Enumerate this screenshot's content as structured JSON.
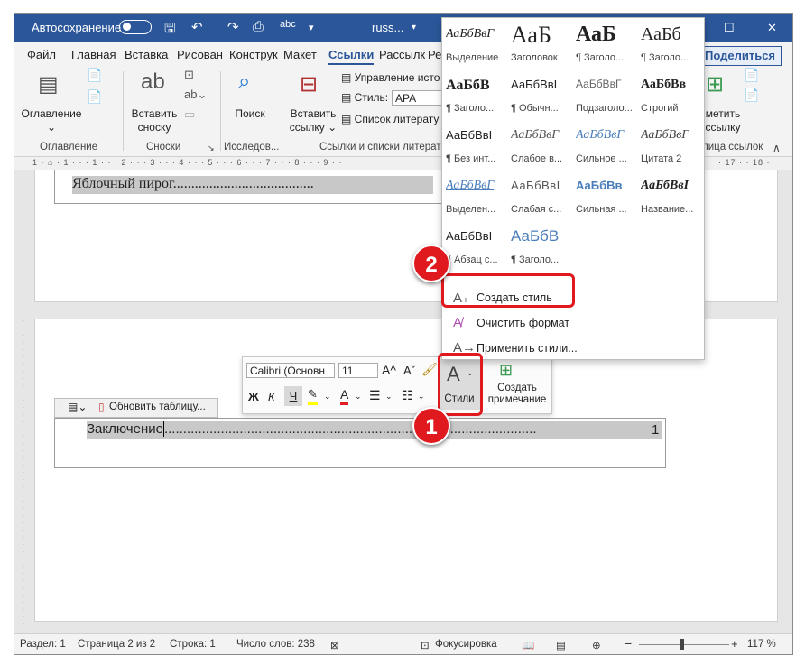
{
  "titlebar": {
    "autosave_label": "Автосохранение",
    "doc_name": "russ...",
    "minimize": "—",
    "maximize": "☐",
    "close": "✕"
  },
  "tabs": [
    "Файл",
    "Главная",
    "Вставка",
    "Рисован",
    "Конструк",
    "Макет",
    "Ссылки",
    "Рассылк",
    "Реце"
  ],
  "share_label": "Поделиться",
  "ribbon": {
    "toc_label": "Оглавление",
    "toc_group": "Оглавление",
    "footnote_label1": "Вставить",
    "footnote_label2": "сноску",
    "footnote_group": "Сноски",
    "search_label": "Поиск",
    "research_group": "Исследов...",
    "citation_label1": "Вставить",
    "citation_label2": "ссылку",
    "manage_sources": "Управление исто",
    "style_label": "Стиль:",
    "style_value": "APA",
    "bibliography": "Список литерату",
    "citations_group": "Ссылки и списки литерат",
    "mark_label1": "метить",
    "mark_label2": "ссылку",
    "mark_group": "лица ссылок",
    "collapse": "∧"
  },
  "ruler_text": "1 · ⌂ · 1 · · · 1 · · · 2 · · · 3 · · · 4 · · · 5 · · · 6 · · · 7 · · · 8 · · · 9 · ·",
  "ruler_right": "· 17 · · 18 ·",
  "page1": {
    "toc_line": "Яблочный пирог......................................."
  },
  "page2": {
    "update_toc": "Обновить таблицу...",
    "toc_entry": "Заключение",
    "toc_dots": "...................................................................................................",
    "toc_page": "1"
  },
  "mini_toolbar": {
    "font_name": "Calibri (Основн",
    "font_size": "11",
    "bold": "Ж",
    "italic": "К",
    "underline": "Ч",
    "styles_label": "Стили",
    "comment_label1": "Создать",
    "comment_label2": "примечание"
  },
  "gallery": {
    "styles": [
      {
        "sample": "АаБбВвГ",
        "name": "Выделение"
      },
      {
        "sample": "АаБ",
        "name": "Заголовок"
      },
      {
        "sample": "АаБ",
        "name": "¶ Заголо..."
      },
      {
        "sample": "АаБб",
        "name": "¶ Заголо..."
      },
      {
        "sample": "АаБбВ",
        "name": "¶ Заголо..."
      },
      {
        "sample": "АаБбВвІ",
        "name": "¶ Обычн..."
      },
      {
        "sample": "АаБбВвГ",
        "name": "Подзаголо..."
      },
      {
        "sample": "АаБбВв",
        "name": "Строгий"
      },
      {
        "sample": "АаБбВвІ",
        "name": "¶ Без инт..."
      },
      {
        "sample": "АаБбВвГ",
        "name": "Слабое в..."
      },
      {
        "sample": "АаБбВвГ",
        "name": "Сильное ..."
      },
      {
        "sample": "АаБбВвГ",
        "name": "Цитата 2"
      },
      {
        "sample": "АаБбВвГ",
        "name": "Выделен..."
      },
      {
        "sample": "АаБбВвІ",
        "name": "Слабая с..."
      },
      {
        "sample": "АаБбВв",
        "name": "Сильная ..."
      },
      {
        "sample": "АаБбВвІ",
        "name": "Название..."
      },
      {
        "sample": "АаБбВвІ",
        "name": "¶ Абзац с..."
      },
      {
        "sample": "АаБбВ",
        "name": "¶ Заголо..."
      }
    ],
    "create_style": "Создать стиль",
    "clear_format": "Очистить формат",
    "apply_styles": "Применить стили..."
  },
  "badges": {
    "one": "1",
    "two": "2"
  },
  "statusbar": {
    "section": "Раздел: 1",
    "page": "Страница 2 из 2",
    "line": "Строка: 1",
    "words": "Число слов: 238",
    "focus": "Фокусировка",
    "zoom_minus": "−",
    "zoom_plus": "+",
    "zoom": "117 %"
  },
  "colors": {
    "accent": "#2b579a",
    "highlight": "#e0191e"
  }
}
